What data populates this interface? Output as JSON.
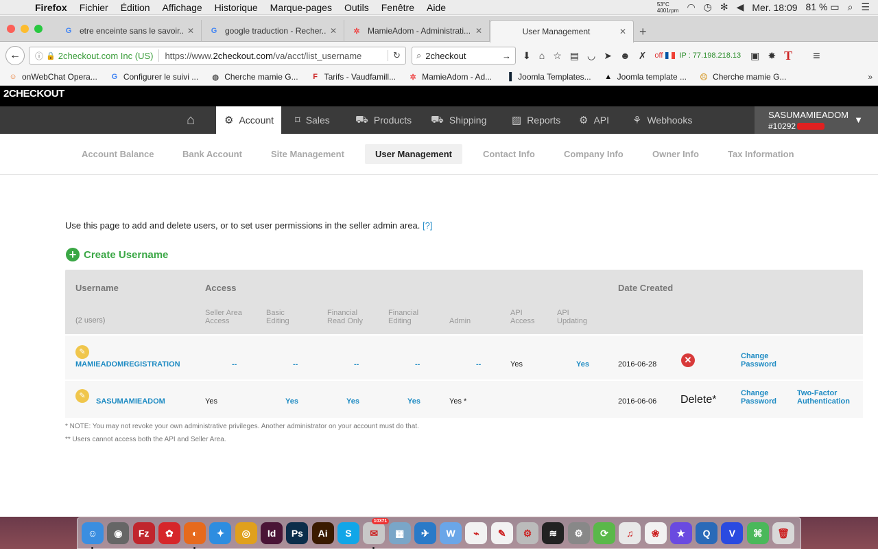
{
  "menubar": {
    "app": "Firefox",
    "items": [
      "Fichier",
      "Édition",
      "Affichage",
      "Historique",
      "Marque-pages",
      "Outils",
      "Fenêtre",
      "Aide"
    ],
    "temp": "53°C",
    "rpm": "4001rpm",
    "datetime": "Mer. 18:09",
    "battery": "81 %"
  },
  "tabs": [
    {
      "title": "etre enceinte sans le savoir...",
      "icon": "google-icon"
    },
    {
      "title": "google traduction - Recher...",
      "icon": "google-icon"
    },
    {
      "title": "MamieAdom - Administrati...",
      "icon": "joomla-icon"
    },
    {
      "title": "User Management",
      "icon": "none"
    }
  ],
  "navbar": {
    "org": "2checkout.com Inc (US)",
    "url_prefix": "https://www.",
    "url_domain": "2checkout.com",
    "url_path": "/va/acct/list_username",
    "search": "2checkout",
    "addon_off": "off",
    "ip": "IP : 77.198.218.13"
  },
  "bookmarks": [
    {
      "label": "onWebChat Opera...",
      "icon": "chat-icon"
    },
    {
      "label": "Configurer le suivi ...",
      "icon": "google-icon"
    },
    {
      "label": "Cherche mamie G...",
      "icon": "globe-icon"
    },
    {
      "label": "Tarifs - Vaudfamill...",
      "icon": "f-icon"
    },
    {
      "label": "MamieAdom - Ad...",
      "icon": "joomla-icon"
    },
    {
      "label": "Joomla Templates...",
      "icon": "template-icon"
    },
    {
      "label": "Joomla template ...",
      "icon": "triangle-icon"
    },
    {
      "label": "Cherche mamie G...",
      "icon": "face-icon"
    }
  ],
  "site": {
    "logo": "2CHECKOUT",
    "nav": [
      {
        "label": "",
        "icon": "home-icon"
      },
      {
        "label": "Account",
        "icon": "gear-icon"
      },
      {
        "label": "Sales",
        "icon": "tag-icon"
      },
      {
        "label": "Products",
        "icon": "cart-icon"
      },
      {
        "label": "Shipping",
        "icon": "truck-icon"
      },
      {
        "label": "Reports",
        "icon": "chart-icon"
      },
      {
        "label": "API",
        "icon": "gears-icon"
      },
      {
        "label": "Webhooks",
        "icon": "webhook-icon"
      }
    ],
    "account_name": "SASUMAMIEADOM",
    "account_number": "#10292",
    "subnav": [
      "Account Balance",
      "Bank Account",
      "Site Management",
      "User Management",
      "Contact Info",
      "Company Info",
      "Owner Info",
      "Tax Information"
    ]
  },
  "content": {
    "intro": "Use this page to add and delete users, or to set user permissions in the seller admin area.",
    "help": "[?]",
    "create": "Create Username",
    "table": {
      "head_username": "Username",
      "head_access": "Access",
      "head_date": "Date Created",
      "user_count": "(2 users)",
      "sub_seller_1": "Seller Area",
      "sub_seller_2": "Access",
      "sub_basic_1": "Basic",
      "sub_basic_2": "Editing",
      "sub_finro_1": "Financial",
      "sub_finro_2": "Read Only",
      "sub_finedit_1": "Financial",
      "sub_finedit_2": "Editing",
      "sub_admin": "Admin",
      "sub_apiacc_1": "API",
      "sub_apiacc_2": "Access",
      "sub_apiupd_1": "API",
      "sub_apiupd_2": "Updating",
      "rows": [
        {
          "username": "MAMIEADOMREGISTRATION",
          "seller": "--",
          "basic": "--",
          "finro": "--",
          "finedit": "--",
          "admin": "--",
          "apiacc": "Yes",
          "apiupd": "Yes",
          "date": "2016-06-28",
          "change_1": "Change",
          "change_2": "Password"
        },
        {
          "username": "SASUMAMIEADOM",
          "seller": "Yes",
          "basic": "Yes",
          "finro": "Yes",
          "finedit": "Yes",
          "admin": "Yes *",
          "date": "2016-06-06",
          "delete": "Delete*",
          "change_1": "Change",
          "change_2": "Password",
          "twofa_1": "Two-Factor",
          "twofa_2": "Authentication"
        }
      ]
    },
    "note1": "* NOTE: You may not revoke your own administrative privileges. Another administrator on your account must do that.",
    "note2": "** Users cannot access both the API and Seller Area."
  },
  "dock": {
    "badge": "10371",
    "apps": [
      {
        "name": "finder-icon",
        "color": "#3b8ee0",
        "glyph": "☺"
      },
      {
        "name": "launchpad-icon",
        "color": "#666",
        "glyph": "◉"
      },
      {
        "name": "filezilla-icon",
        "color": "#c0262d",
        "glyph": "Fz"
      },
      {
        "name": "strawberry-icon",
        "color": "#d6262a",
        "glyph": "✿"
      },
      {
        "name": "firefox-icon",
        "color": "#e66a1d",
        "glyph": "◐"
      },
      {
        "name": "safari-icon",
        "color": "#2d8de0",
        "glyph": "✦"
      },
      {
        "name": "chrome-icon",
        "color": "#e0a01d",
        "glyph": "◎"
      },
      {
        "name": "indesign-icon",
        "color": "#4a1436",
        "glyph": "Id"
      },
      {
        "name": "photoshop-icon",
        "color": "#0b2d4a",
        "glyph": "Ps"
      },
      {
        "name": "illustrator-icon",
        "color": "#3a1a00",
        "glyph": "Ai"
      },
      {
        "name": "skype-icon",
        "color": "#11a6e8",
        "glyph": "S"
      },
      {
        "name": "mail-icon",
        "color": "#c8c8c8",
        "glyph": "✉"
      },
      {
        "name": "preview-icon",
        "color": "#7aa6c8",
        "glyph": "▦"
      },
      {
        "name": "bird-icon",
        "color": "#2a7ac8",
        "glyph": "✈"
      },
      {
        "name": "wunderlist-icon",
        "color": "#6aa6e8",
        "glyph": "W"
      },
      {
        "name": "acrobat-icon",
        "color": "#f2f2f2",
        "glyph": "⌁"
      },
      {
        "name": "textedit-icon",
        "color": "#f2f2f2",
        "glyph": "✎"
      },
      {
        "name": "script-icon",
        "color": "#bbb",
        "glyph": "⚙"
      },
      {
        "name": "activity-monitor-icon",
        "color": "#222",
        "glyph": "≋"
      },
      {
        "name": "preferences-icon",
        "color": "#888",
        "glyph": "⚙"
      },
      {
        "name": "sync-icon",
        "color": "#5ab84a",
        "glyph": "⟳"
      },
      {
        "name": "itunes-icon",
        "color": "#e8e8e8",
        "glyph": "♫"
      },
      {
        "name": "photos-icon",
        "color": "#f2f2f2",
        "glyph": "❀"
      },
      {
        "name": "imovie-icon",
        "color": "#6a4ae0",
        "glyph": "★"
      },
      {
        "name": "quicktime-icon",
        "color": "#2a6ab8",
        "glyph": "Q"
      },
      {
        "name": "vectorize-icon",
        "color": "#2a4ae0",
        "glyph": "V"
      },
      {
        "name": "network-icon",
        "color": "#4ab85a",
        "glyph": "⌘"
      },
      {
        "name": "trash-icon",
        "color": "#d8d8d8",
        "glyph": "🗑"
      }
    ]
  }
}
